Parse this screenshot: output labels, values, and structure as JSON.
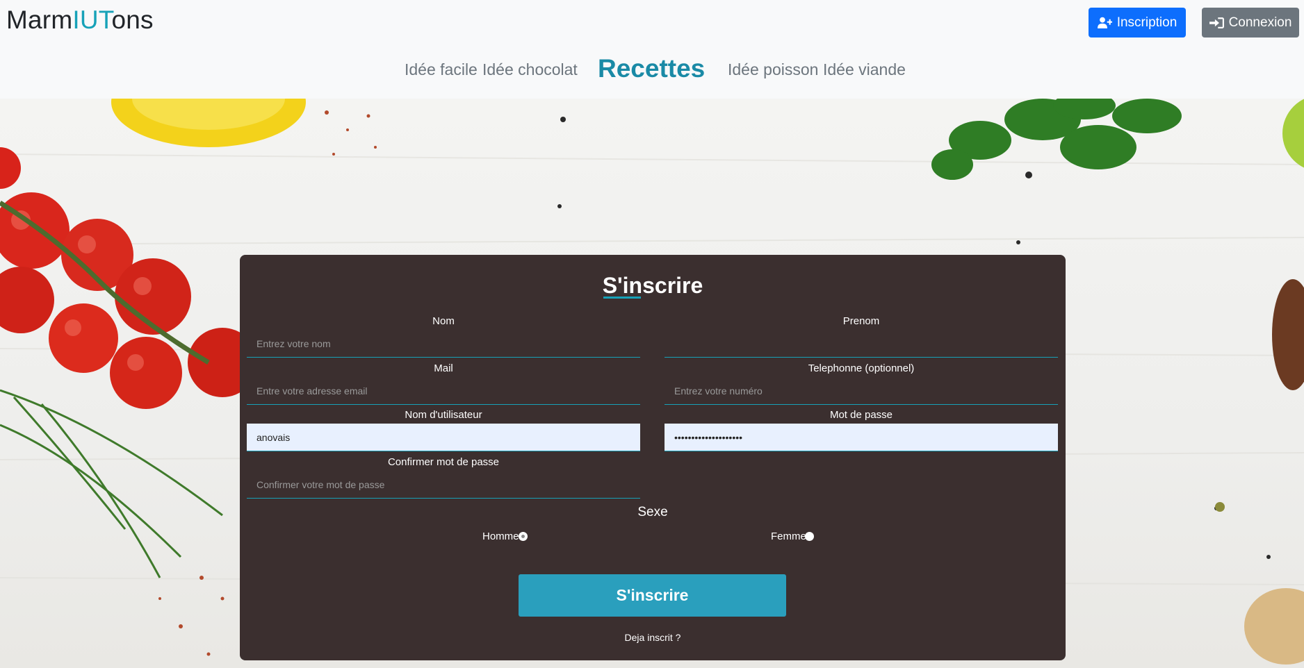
{
  "header": {
    "logo_part1": "Marm",
    "logo_accent": "IUT",
    "logo_part2": "ons",
    "inscription_label": "Inscription",
    "connexion_label": "Connexion"
  },
  "nav": {
    "items": [
      "Idée facile",
      "Idée chocolat",
      "Recettes",
      "Idée poisson",
      "Idée viande"
    ]
  },
  "form": {
    "title": "S'inscrire",
    "nom_label": "Nom",
    "nom_placeholder": "Entrez votre nom",
    "prenom_label": "Prenom",
    "prenom_placeholder": "",
    "mail_label": "Mail",
    "mail_placeholder": "Entre votre adresse email",
    "tel_label": "Telephonne (optionnel)",
    "tel_placeholder": "Entrez votre numéro",
    "username_label": "Nom d'utilisateur",
    "username_value": "anovais",
    "password_label": "Mot de passe",
    "password_value": "••••••••••••••••••••",
    "confirm_label": "Confirmer mot de passe",
    "confirm_placeholder": "Confirmer votre mot de passe",
    "sexe_label": "Sexe",
    "homme_label": "Homme",
    "femme_label": "Femme",
    "submit_label": "S'inscrire",
    "deja_label": "Deja inscrit ?"
  },
  "colors": {
    "accent": "#17a2b8",
    "primary_button": "#0d6efd",
    "secondary_button": "#6c757d",
    "panel": "#3b2f2f",
    "submit": "#2a9fbd"
  },
  "icons": {
    "inscription": "user-plus-icon",
    "connexion": "sign-in-icon"
  }
}
